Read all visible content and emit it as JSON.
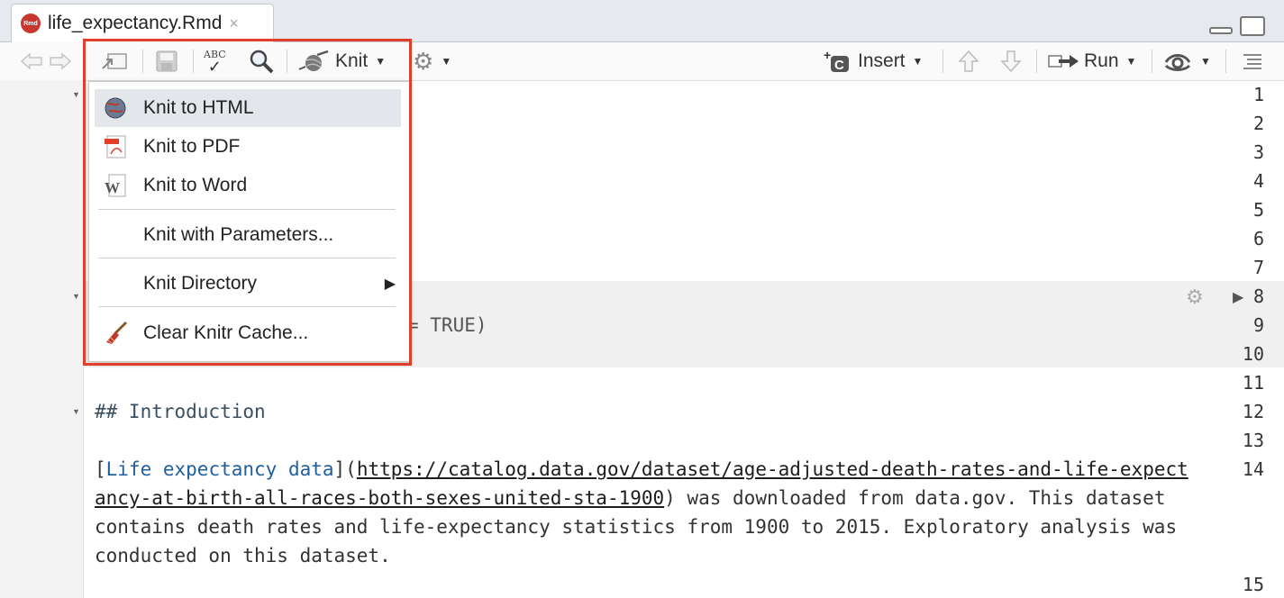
{
  "tab": {
    "title": "life_expectancy.Rmd",
    "icon": "rmd-file-icon",
    "close": "×"
  },
  "toolbar": {
    "abc": "ABC",
    "knit_label": "Knit",
    "insert_label": "Insert",
    "run_label": "Run"
  },
  "knit_menu": {
    "items": [
      {
        "label": "Knit to HTML",
        "icon": "html-globe-icon"
      },
      {
        "label": "Knit to PDF",
        "icon": "pdf-icon"
      },
      {
        "label": "Knit to Word",
        "icon": "word-icon"
      },
      {
        "label": "Knit with Parameters..."
      },
      {
        "label": "Knit Directory",
        "icon": "submenu-arrow-icon"
      },
      {
        "label": "Clear Knitr Cache...",
        "icon": "broom-icon"
      }
    ]
  },
  "editor": {
    "line_numbers": [
      "1",
      "2",
      "3",
      "4",
      "5",
      "6",
      "7",
      "8",
      "9",
      "10",
      "11",
      "12",
      "13",
      "14",
      "15"
    ],
    "lines": {
      "l8_partial": "}",
      "l9_partial": "= TRUE)",
      "l12": "## Introduction",
      "l14_link_text": "Life expectancy data",
      "l14_url_part1": "https://catalog.data.gov/dataset/age-adjusted-death-rates-and-life-expect",
      "l14_url_part2": "ancy-at-birth-all-races-both-sexes-united-sta-1900",
      "l14_rest1": " was downloaded from data.gov. This dataset",
      "l14_line3": "contains death rates and life-expectancy statistics from 1900 to 2015. Exploratory analysis was",
      "l14_line4": "conducted on this dataset."
    }
  },
  "colors": {
    "highlight_border": "#e23e2b",
    "menu_selected": "#e3e6ea"
  }
}
